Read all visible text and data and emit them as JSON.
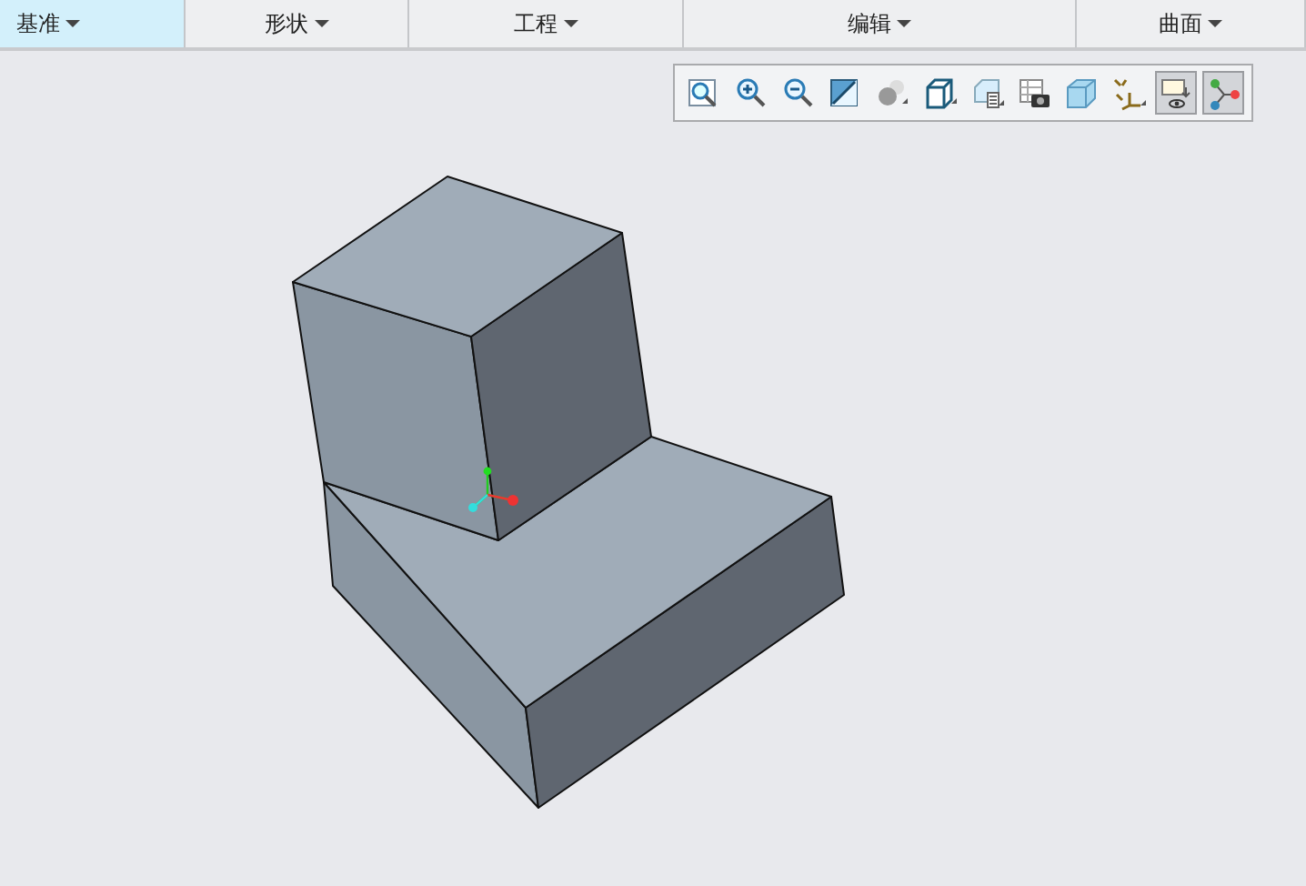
{
  "tabs": [
    {
      "label": "基准",
      "selected": true
    },
    {
      "label": "形状",
      "selected": false
    },
    {
      "label": "工程",
      "selected": false
    },
    {
      "label": "编辑",
      "selected": false
    },
    {
      "label": "曲面",
      "selected": false
    }
  ],
  "toolbar": [
    {
      "kind": "zoom-fit",
      "on": false
    },
    {
      "kind": "zoom-in",
      "on": false
    },
    {
      "kind": "zoom-out",
      "on": false
    },
    {
      "kind": "repaint",
      "on": false
    },
    {
      "kind": "shading",
      "on": false
    },
    {
      "kind": "cube",
      "on": false
    },
    {
      "kind": "saved-view",
      "on": false
    },
    {
      "kind": "camera",
      "on": false
    },
    {
      "kind": "section",
      "on": false
    },
    {
      "kind": "datum",
      "on": false
    },
    {
      "kind": "display",
      "on": true
    },
    {
      "kind": "nodes",
      "on": true
    }
  ]
}
